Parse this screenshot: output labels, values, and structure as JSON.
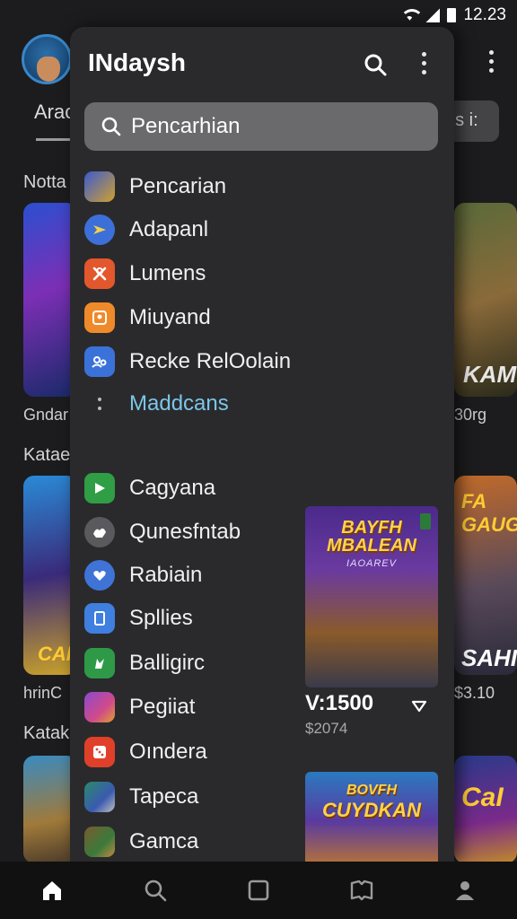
{
  "status_bar": {
    "time": "12.23"
  },
  "background": {
    "tab_label": "Arac",
    "chip_label": "ns i:",
    "sections": [
      "Notta",
      "Katae",
      "Katak"
    ],
    "left_captions": [
      "Gndar",
      "hrinC"
    ],
    "right_captions": [
      "30rg",
      "$3.10"
    ],
    "right_card_texts": [
      "KAM",
      "FA GAUG",
      "SAHI",
      "CaI"
    ],
    "left_card_texts": [
      "CAI"
    ]
  },
  "drawer": {
    "title": "INdaysh",
    "search": {
      "placeholder": "Pencarhian"
    },
    "menu_top": [
      {
        "label": "Pencarian",
        "icon": "game-thumb-icon",
        "color": "#3a5bd0"
      },
      {
        "label": "Adapanl",
        "icon": "send-icon",
        "color": "#3d6fd8"
      },
      {
        "label": "Lumens",
        "icon": "x-badge-icon",
        "color": "#e2572c"
      },
      {
        "label": "Miuyand",
        "icon": "profile-card-icon",
        "color": "#ef8a2a"
      },
      {
        "label": "Recke RelOolain",
        "icon": "people-icon",
        "color": "#3b72d9"
      }
    ],
    "more_label": "Maddcans",
    "menu_bottom": [
      {
        "label": "Cagyana",
        "icon": "flag-icon",
        "color": "#2f9e45"
      },
      {
        "label": "Qunesfntab",
        "icon": "shapes-icon",
        "color": "#5a5a5e"
      },
      {
        "label": "Rabiain",
        "icon": "heart-icon",
        "color": "#3f73d6"
      },
      {
        "label": "Spllies",
        "icon": "document-icon",
        "color": "#3f7fe0"
      },
      {
        "label": "Balligirc",
        "icon": "leaf-icon",
        "color": "#2e9a48"
      },
      {
        "label": "Pegiiat",
        "icon": "game-thumb-icon",
        "color": "#8a4ad0"
      },
      {
        "label": "Oındera",
        "icon": "dice-icon",
        "color": "#e0402a"
      },
      {
        "label": "Tapeca",
        "icon": "game-thumb-icon",
        "color": "#2a8a6a"
      },
      {
        "label": "Gamca",
        "icon": "game-thumb-icon",
        "color": "#7a5a30"
      }
    ],
    "promo": {
      "title_line1": "BAYFH",
      "title_line2": "MBALEAN",
      "subtitle": "IAOAREV",
      "price": "V:1500",
      "old_price": "$2074"
    },
    "promo2": {
      "title_line1": "BOVFH",
      "title_line2": "CUYDKAN"
    }
  },
  "bottom_nav": [
    "home-icon",
    "search-icon",
    "square-icon",
    "book-icon",
    "profile-icon"
  ]
}
